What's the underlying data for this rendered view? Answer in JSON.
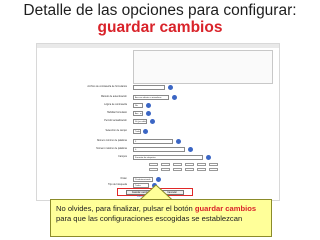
{
  "slide": {
    "title_line1": "Detalle de las opciones para configurar:",
    "title_line2": "guardar cambios"
  },
  "form": {
    "rows": [
      {
        "label": "Archivo de contraseña de formularios",
        "value": ""
      },
      {
        "label": "Método de autenticación",
        "value": "Acceso abierto a miembros"
      },
      {
        "label": "Lógica de contraseña",
        "value": "No"
      },
      {
        "label": "Habilitar formulario",
        "value": "Acc. a d."
      },
      {
        "label": "Permitir actualización",
        "value": "Sí (por defecto)"
      },
      {
        "label": "Selección de campo",
        "value": "Todos"
      },
      {
        "label": "Número mínimo de palabras",
        "value": "3"
      },
      {
        "label": "Número máximo de palabras",
        "value": "0"
      },
      {
        "label": "Campos",
        "value": "Formato de etiquetas"
      },
      {
        "label": "Orden",
        "value": "Predeterminado"
      },
      {
        "label": "Tipo de búsqueda",
        "value": "Todos"
      }
    ],
    "save_button": "Guardar cambios",
    "cancel_button": "Cancelar",
    "footer_link": "Moodle Docs para esta página"
  },
  "callout": {
    "text_a": "No olvides, para finalizar, pulsar el botón ",
    "highlight": "guardar cambios",
    "text_b": "para que las configuraciones escogidas se establezcan"
  },
  "colors": {
    "title_accent": "#d9232a",
    "callout_bg": "#ffff99",
    "highlight_box": "#e02828",
    "help_icon": "#3b66c4"
  }
}
